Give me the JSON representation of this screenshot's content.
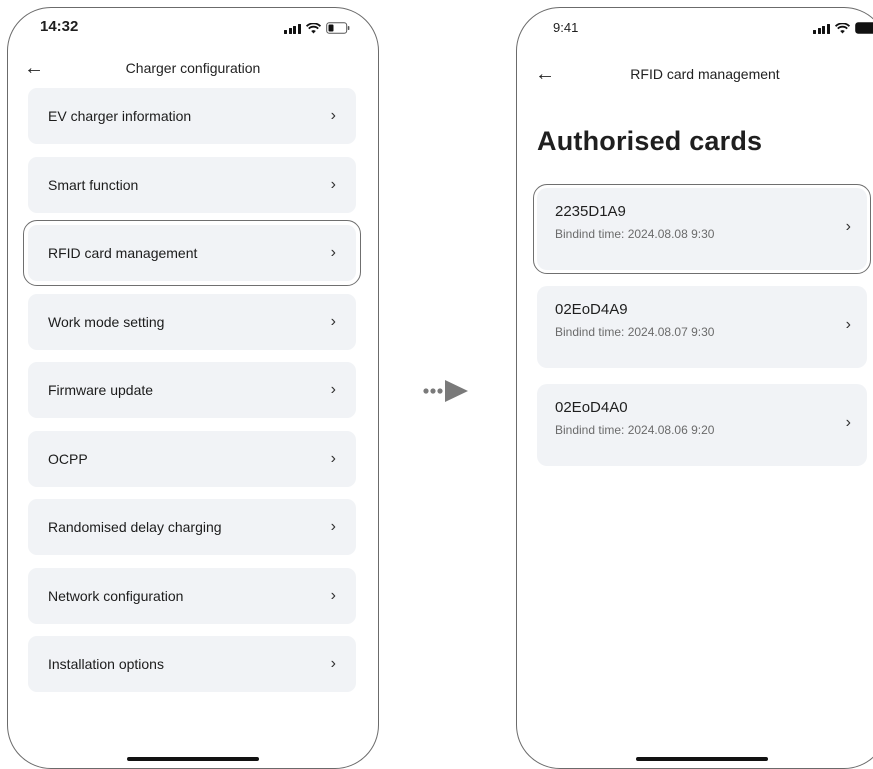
{
  "left_phone": {
    "status": {
      "time": "14:32"
    },
    "nav": {
      "title": "Charger configuration"
    },
    "menu": [
      {
        "label": "EV charger information"
      },
      {
        "label": "Smart function"
      },
      {
        "label": "RFID card management",
        "highlighted": true
      },
      {
        "label": "Work mode setting"
      },
      {
        "label": "Firmware update"
      },
      {
        "label": "OCPP"
      },
      {
        "label": "Randomised delay charging"
      },
      {
        "label": "Network configuration"
      },
      {
        "label": "Installation options"
      }
    ]
  },
  "right_phone": {
    "status": {
      "time": "9:41"
    },
    "nav": {
      "title": "RFID card management"
    },
    "heading": "Authorised cards",
    "cards": [
      {
        "id": "2235D1A9",
        "binding": "Bindind time: 2024.08.08 9:30",
        "highlighted": true
      },
      {
        "id": "02EoD4A9",
        "binding": "Bindind time: 2024.08.07 9:30"
      },
      {
        "id": "02EoD4A0",
        "binding": "Bindind time: 2024.08.06 9:20"
      }
    ]
  },
  "icons": {
    "back": "arrow-left-icon",
    "chevron": "chevron-right-icon",
    "signal": "cellular-signal-icon",
    "wifi": "wifi-icon",
    "battery": "battery-icon",
    "connector": "dotted-arrow-right-icon"
  },
  "colors": {
    "item_background": "#f1f3f6",
    "highlight_outline": "#6f6f6f",
    "connector_arrow": "#7a7a7a"
  }
}
